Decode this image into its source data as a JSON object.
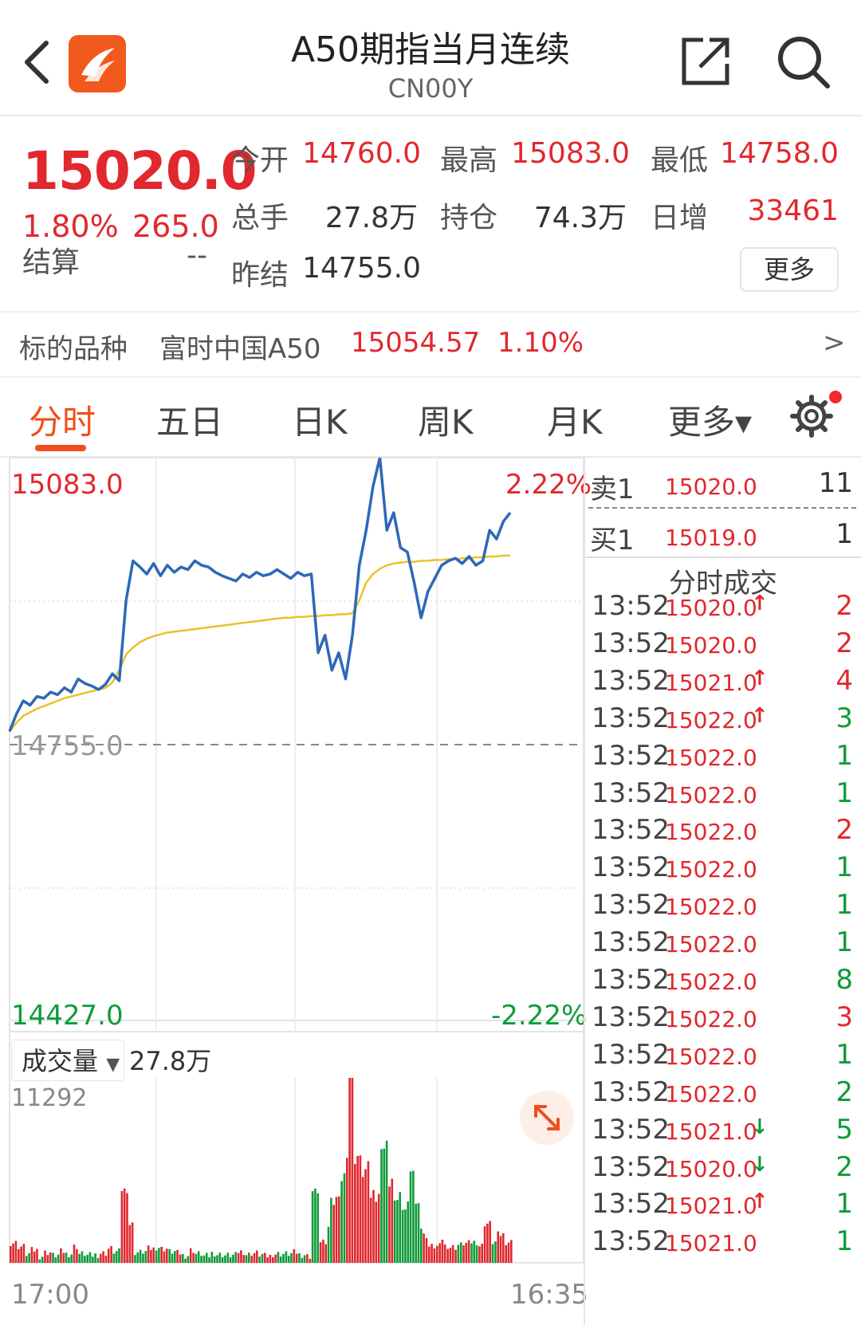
{
  "header": {
    "title": "A50期指当月连续",
    "code": "CN00Y"
  },
  "quote": {
    "price": "15020.0",
    "change_pct": "1.80%",
    "change": "265.0",
    "settle_label": "结算",
    "settle_value": "--",
    "open_label": "今开",
    "open_value": "14760.0",
    "high_label": "最高",
    "high_value": "15083.0",
    "low_label": "最低",
    "low_value": "14758.0",
    "volume_label": "总手",
    "volume_value": "27.8万",
    "oi_label": "持仓",
    "oi_value": "74.3万",
    "daily_inc_label": "日增",
    "daily_inc_value": "33461",
    "prev_settle_label": "昨结",
    "prev_settle_value": "14755.0",
    "more_label": "更多"
  },
  "underlying": {
    "label": "标的品种",
    "name": "富时中国A50",
    "price": "15054.57",
    "change_pct": "1.10%",
    "arrow": ">"
  },
  "tabs": [
    {
      "label": "分时",
      "active": true
    },
    {
      "label": "五日"
    },
    {
      "label": "日K"
    },
    {
      "label": "周K"
    },
    {
      "label": "月K"
    },
    {
      "label": "更多▾"
    }
  ],
  "chart_data": {
    "type": "line",
    "y_max_label": "15083.0",
    "y_max_pct": "2.22%",
    "y_mid_label": "14755.0",
    "y_min_label": "14427.0",
    "y_min_pct": "-2.22%",
    "ylim": [
      14427.0,
      15083.0
    ],
    "baseline": 14755.0,
    "x_start": "17:00",
    "x_end": "16:35",
    "series": [
      {
        "values": [
          14770,
          14790,
          14805,
          14800,
          14810,
          14808,
          14815,
          14812,
          14820,
          14815,
          14830,
          14825,
          14822,
          14818,
          14824,
          14836,
          14828,
          14920,
          14965,
          14958,
          14950,
          14962,
          14948,
          14960,
          14952,
          14958,
          14955,
          14965,
          14960,
          14958,
          14952,
          14948,
          14945,
          14942,
          14950,
          14946,
          14952,
          14948,
          14950,
          14955,
          14950,
          14945,
          14952,
          14948,
          14950,
          14860,
          14880,
          14840,
          14860,
          14830,
          14880,
          14960,
          15000,
          15050,
          15083,
          15000,
          15020,
          14980,
          14975,
          14940,
          14900,
          14930,
          14945,
          14960,
          14965,
          14968,
          14962,
          14970,
          14960,
          14965,
          15000,
          14990,
          15010,
          15020
        ]
      },
      {
        "values": [
          14770,
          14780,
          14788,
          14792,
          14796,
          14799,
          14802,
          14805,
          14808,
          14810,
          14812,
          14814,
          14816,
          14818,
          14820,
          14826,
          14840,
          14858,
          14866,
          14872,
          14876,
          14879,
          14881,
          14883,
          14884,
          14885,
          14886,
          14887,
          14888,
          14889,
          14890,
          14891,
          14892,
          14893,
          14894,
          14895,
          14896,
          14897,
          14898,
          14899,
          14900,
          14900,
          14901,
          14901,
          14902,
          14902,
          14903,
          14903,
          14904,
          14904,
          14905,
          14920,
          14940,
          14950,
          14956,
          14960,
          14962,
          14963,
          14964,
          14964,
          14965,
          14965,
          14966,
          14966,
          14967,
          14967,
          14968,
          14968,
          14969,
          14969,
          14970,
          14970,
          14971,
          14971
        ]
      }
    ],
    "volume": {
      "label": "成交量",
      "total": "27.8万",
      "max_label": "11292",
      "max": 11292
    }
  },
  "order_book": {
    "ask": {
      "label": "卖1",
      "price": "15020.0",
      "volume": "11"
    },
    "bid": {
      "label": "买1",
      "price": "15019.0",
      "volume": "1"
    },
    "trades_title": "分时成交",
    "trades": [
      {
        "time": "13:52",
        "price": "15020.0",
        "arrow": "↑",
        "vol": "2",
        "side": "red"
      },
      {
        "time": "13:52",
        "price": "15020.0",
        "arrow": "",
        "vol": "2",
        "side": "red"
      },
      {
        "time": "13:52",
        "price": "15021.0",
        "arrow": "↑",
        "vol": "4",
        "side": "red"
      },
      {
        "time": "13:52",
        "price": "15022.0",
        "arrow": "↑",
        "vol": "3",
        "side": "green"
      },
      {
        "time": "13:52",
        "price": "15022.0",
        "arrow": "",
        "vol": "1",
        "side": "green"
      },
      {
        "time": "13:52",
        "price": "15022.0",
        "arrow": "",
        "vol": "1",
        "side": "green"
      },
      {
        "time": "13:52",
        "price": "15022.0",
        "arrow": "",
        "vol": "2",
        "side": "red"
      },
      {
        "time": "13:52",
        "price": "15022.0",
        "arrow": "",
        "vol": "1",
        "side": "green"
      },
      {
        "time": "13:52",
        "price": "15022.0",
        "arrow": "",
        "vol": "1",
        "side": "green"
      },
      {
        "time": "13:52",
        "price": "15022.0",
        "arrow": "",
        "vol": "1",
        "side": "green"
      },
      {
        "time": "13:52",
        "price": "15022.0",
        "arrow": "",
        "vol": "8",
        "side": "green"
      },
      {
        "time": "13:52",
        "price": "15022.0",
        "arrow": "",
        "vol": "3",
        "side": "red"
      },
      {
        "time": "13:52",
        "price": "15022.0",
        "arrow": "",
        "vol": "1",
        "side": "green"
      },
      {
        "time": "13:52",
        "price": "15022.0",
        "arrow": "",
        "vol": "2",
        "side": "green"
      },
      {
        "time": "13:52",
        "price": "15021.0",
        "arrow": "↓",
        "vol": "5",
        "side": "green"
      },
      {
        "time": "13:52",
        "price": "15020.0",
        "arrow": "↓",
        "vol": "2",
        "side": "green"
      },
      {
        "time": "13:52",
        "price": "15021.0",
        "arrow": "↑",
        "vol": "1",
        "side": "green"
      },
      {
        "time": "13:52",
        "price": "15021.0",
        "arrow": "",
        "vol": "1",
        "side": "green"
      }
    ]
  },
  "colors": {
    "up": "#e0282e",
    "down": "#0f9b3a",
    "price_line": "#2e68b8",
    "avg_line": "#e8c32a",
    "accent": "#f04e1b"
  }
}
